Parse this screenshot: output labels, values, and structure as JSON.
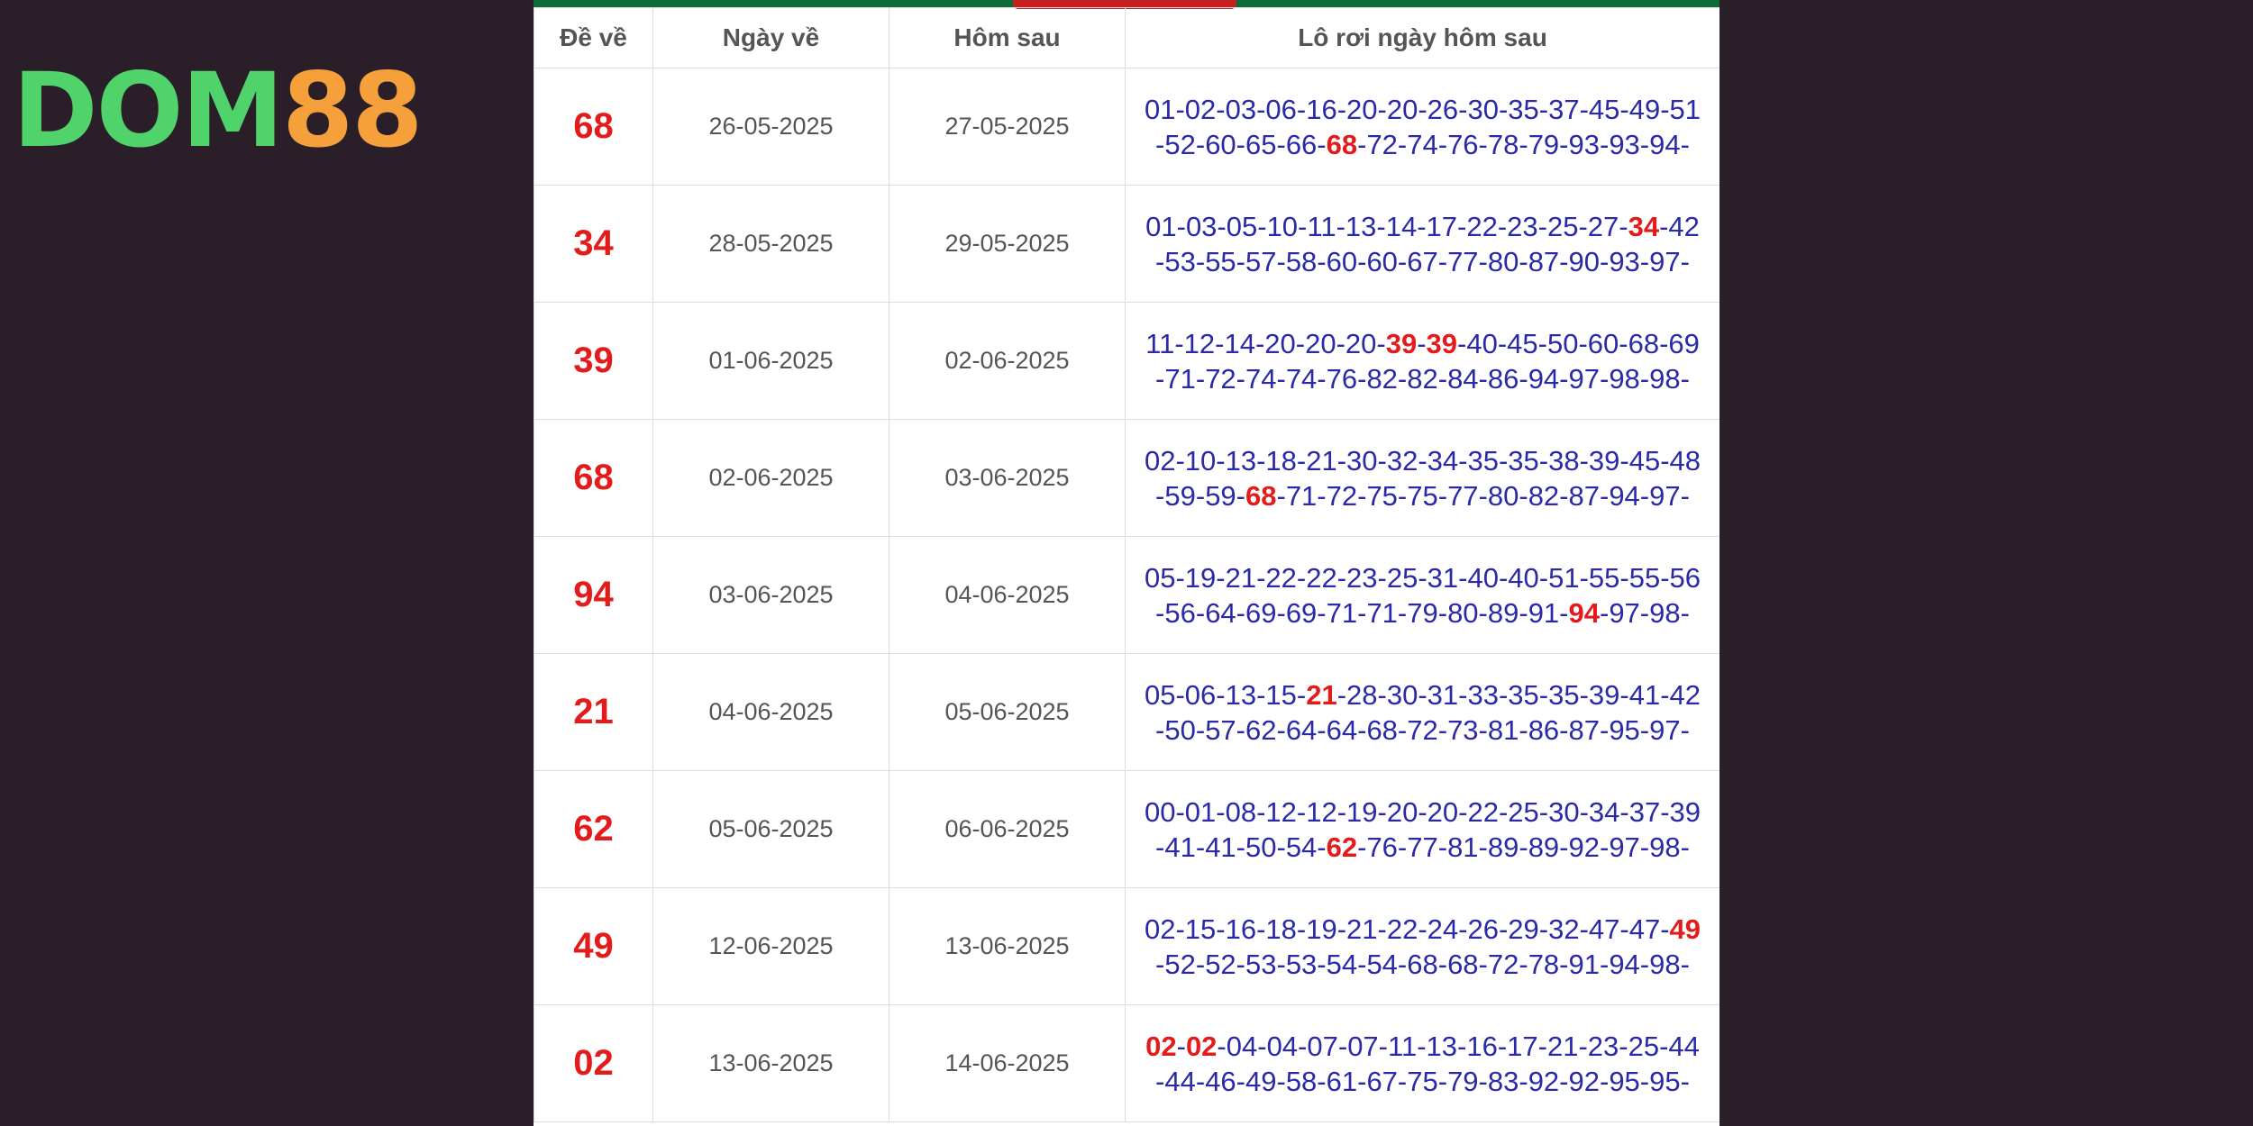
{
  "logo": {
    "part1": "DOM",
    "part2": "88"
  },
  "table": {
    "headers": [
      "Đề về",
      "Ngày về",
      "Hôm sau",
      "Lô rơi ngày hôm sau"
    ],
    "rows": [
      {
        "de": "68",
        "ngay_ve": "26-05-2025",
        "hom_sau": "27-05-2025",
        "lo": [
          "01",
          "02",
          "03",
          "06",
          "16",
          "20",
          "20",
          "26",
          "30",
          "35",
          "37",
          "45",
          "49",
          "51",
          "52",
          "60",
          "65",
          "66",
          "68",
          "72",
          "74",
          "76",
          "78",
          "79",
          "93",
          "93",
          "94"
        ]
      },
      {
        "de": "34",
        "ngay_ve": "28-05-2025",
        "hom_sau": "29-05-2025",
        "lo": [
          "01",
          "03",
          "05",
          "10",
          "11",
          "13",
          "14",
          "17",
          "22",
          "23",
          "25",
          "27",
          "34",
          "42",
          "53",
          "55",
          "57",
          "58",
          "60",
          "60",
          "67",
          "77",
          "80",
          "87",
          "90",
          "93",
          "97"
        ]
      },
      {
        "de": "39",
        "ngay_ve": "01-06-2025",
        "hom_sau": "02-06-2025",
        "lo": [
          "11",
          "12",
          "14",
          "20",
          "20",
          "20",
          "39",
          "39",
          "40",
          "45",
          "50",
          "60",
          "68",
          "69",
          "71",
          "72",
          "74",
          "74",
          "76",
          "82",
          "82",
          "84",
          "86",
          "94",
          "97",
          "98",
          "98"
        ]
      },
      {
        "de": "68",
        "ngay_ve": "02-06-2025",
        "hom_sau": "03-06-2025",
        "lo": [
          "02",
          "10",
          "13",
          "18",
          "21",
          "30",
          "32",
          "34",
          "35",
          "35",
          "38",
          "39",
          "45",
          "48",
          "59",
          "59",
          "68",
          "71",
          "72",
          "75",
          "75",
          "77",
          "80",
          "82",
          "87",
          "94",
          "97"
        ]
      },
      {
        "de": "94",
        "ngay_ve": "03-06-2025",
        "hom_sau": "04-06-2025",
        "lo": [
          "05",
          "19",
          "21",
          "22",
          "22",
          "23",
          "25",
          "31",
          "40",
          "40",
          "51",
          "55",
          "55",
          "56",
          "56",
          "64",
          "69",
          "69",
          "71",
          "71",
          "79",
          "80",
          "89",
          "91",
          "94",
          "97",
          "98"
        ]
      },
      {
        "de": "21",
        "ngay_ve": "04-06-2025",
        "hom_sau": "05-06-2025",
        "lo": [
          "05",
          "06",
          "13",
          "15",
          "21",
          "28",
          "30",
          "31",
          "33",
          "35",
          "35",
          "39",
          "41",
          "42",
          "50",
          "57",
          "62",
          "64",
          "64",
          "68",
          "72",
          "73",
          "81",
          "86",
          "87",
          "95",
          "97"
        ]
      },
      {
        "de": "62",
        "ngay_ve": "05-06-2025",
        "hom_sau": "06-06-2025",
        "lo": [
          "00",
          "01",
          "08",
          "12",
          "12",
          "19",
          "20",
          "20",
          "22",
          "25",
          "30",
          "34",
          "37",
          "39",
          "41",
          "41",
          "50",
          "54",
          "62",
          "76",
          "77",
          "81",
          "89",
          "89",
          "92",
          "97",
          "98"
        ]
      },
      {
        "de": "49",
        "ngay_ve": "12-06-2025",
        "hom_sau": "13-06-2025",
        "lo": [
          "02",
          "15",
          "16",
          "18",
          "19",
          "21",
          "22",
          "24",
          "26",
          "29",
          "32",
          "47",
          "47",
          "49",
          "52",
          "52",
          "53",
          "53",
          "54",
          "54",
          "68",
          "68",
          "72",
          "78",
          "91",
          "94",
          "98"
        ]
      },
      {
        "de": "02",
        "ngay_ve": "13-06-2025",
        "hom_sau": "14-06-2025",
        "lo": [
          "02",
          "02",
          "04",
          "04",
          "07",
          "07",
          "11",
          "13",
          "16",
          "17",
          "21",
          "23",
          "25",
          "44",
          "44",
          "46",
          "49",
          "58",
          "61",
          "67",
          "75",
          "79",
          "83",
          "92",
          "92",
          "95",
          "95"
        ]
      }
    ]
  },
  "colors": {
    "highlight": "#e31b1b",
    "lo_text": "#2a2aa8",
    "brand_green": "#4fd36a",
    "brand_orange": "#f5a03a"
  }
}
